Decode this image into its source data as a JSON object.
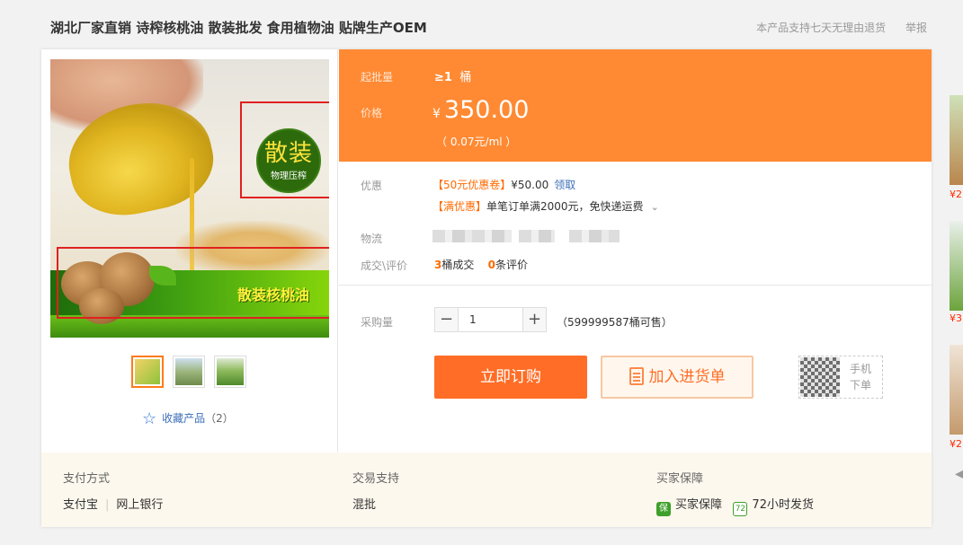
{
  "header": {
    "title": "湖北厂家直销 诗榨核桃油 散装批发 食用植物油 贴牌生产OEM",
    "links": [
      "本产品支持七天无理由退货",
      "举报"
    ]
  },
  "gallery": {
    "badge_main": "散装",
    "badge_sub": "物理压榨",
    "banner_text": "散装核桃油",
    "thumbnails": [
      "thumb-1",
      "thumb-2",
      "thumb-3"
    ],
    "favorite_label": "收藏产品",
    "favorite_count": "（2）"
  },
  "price": {
    "min_label": "起批量",
    "min_value": "≥1",
    "min_unit": "桶",
    "price_label": "价格",
    "currency": "¥",
    "price_value": "350.00",
    "unit_price": "（ 0.07元/ml ）"
  },
  "details": {
    "promo_label": "优惠",
    "promo1_tag": "【50元优惠卷】",
    "promo1_value": "¥50.00",
    "promo1_link": "领取",
    "promo2_tag": "【满优惠】",
    "promo2_text": "单笔订单满2000元，免快递运费",
    "logistics_label": "物流",
    "deal_label": "成交\\评价",
    "deal_count": "3",
    "deal_unit": "桶成交",
    "review_count": "0",
    "review_unit": "条评价"
  },
  "purchase": {
    "qty_label": "采购量",
    "qty_value": "1",
    "stock": "（599999587桶可售）",
    "buy_label": "立即订购",
    "cart_label": "加入进货单",
    "mobile_line1": "手机",
    "mobile_line2": "下单"
  },
  "footer": {
    "payment_title": "支付方式",
    "payment_items": [
      "支付宝",
      "网上银行"
    ],
    "trade_title": "交易支持",
    "trade_items": [
      "混批"
    ],
    "guarantee_title": "买家保障",
    "guarantee_items": [
      "买家保障",
      "72小时发货"
    ],
    "guarantee_icon_labels": [
      "保",
      "72"
    ]
  },
  "sidebar": {
    "prices": [
      "¥2",
      "¥3",
      "¥2"
    ]
  },
  "colors": {
    "accent": "#ff8a33",
    "buy_button": "#ff6d26",
    "promo_text": "#ff6a00",
    "link": "#3d6fb8",
    "highlight_box": "#e02020"
  },
  "icons": [
    "star-icon",
    "minus-icon",
    "plus-icon",
    "cart-list-icon",
    "qr-code-icon",
    "shield-icon",
    "72h-icon",
    "chevron-down-icon",
    "chevron-left-icon"
  ]
}
